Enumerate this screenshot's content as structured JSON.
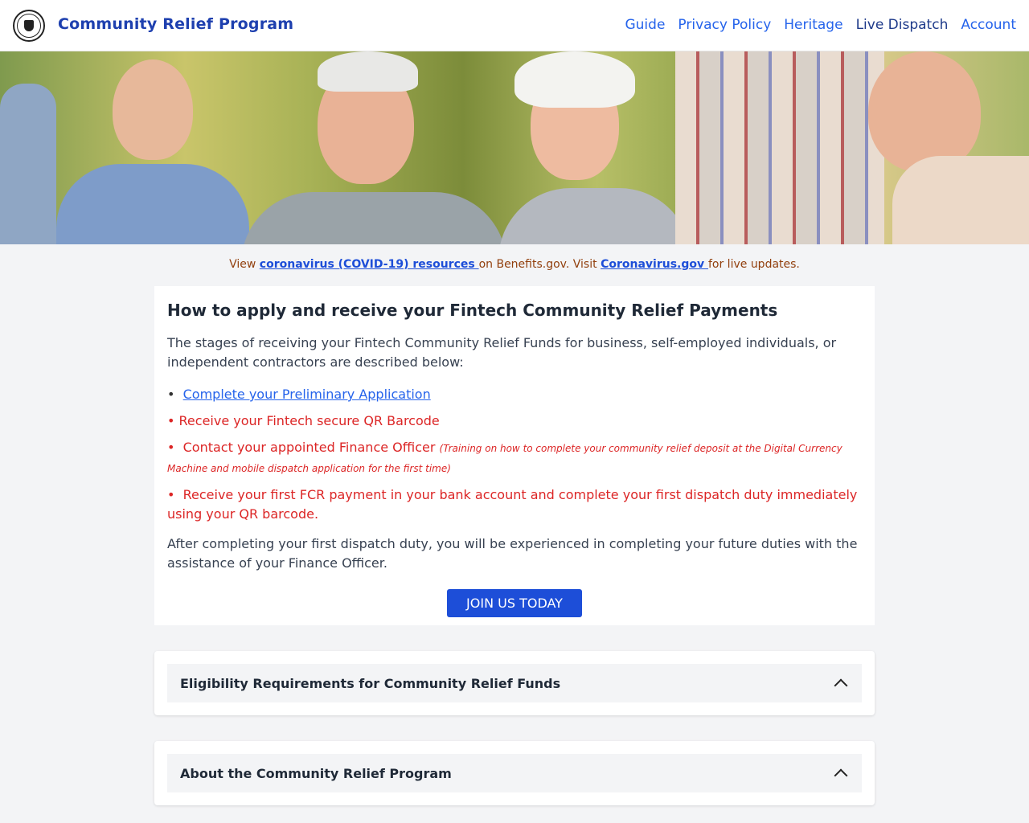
{
  "header": {
    "brand": "Community Relief Program",
    "nav": [
      {
        "label": "Guide"
      },
      {
        "label": "Privacy Policy"
      },
      {
        "label": "Heritage"
      },
      {
        "label": "Live Dispatch"
      },
      {
        "label": "Account"
      }
    ]
  },
  "notice": {
    "prefix": "View ",
    "link1": "coronavirus (COVID-19) resources ",
    "middle": "on Benefits.gov. Visit ",
    "link2": "Coronavirus.gov ",
    "suffix": "for live updates."
  },
  "main": {
    "title": "How to apply and receive your Fintech Community Relief Payments",
    "intro": "The stages of receiving your Fintech Community Relief Funds for business, self-employed individuals, or independent contractors are described below:",
    "steps": [
      {
        "text": "Complete your Preliminary Application"
      },
      {
        "text": "Receive your Fintech secure QR Barcode"
      },
      {
        "text": "Contact your appointed Finance Officer",
        "note": "(Training on how to complete your community relief deposit at the Digital Currency Machine and mobile dispatch application for the first time)"
      },
      {
        "text": "Receive your first FCR payment in your bank account and complete your first dispatch duty immediately using your QR barcode."
      }
    ],
    "outro": "After completing your first dispatch duty, you will be experienced in completing your future duties with the assistance of your Finance Officer.",
    "join_label": "JOIN US TODAY"
  },
  "accordions": [
    {
      "title": "Eligibility Requirements for Community Relief Funds"
    },
    {
      "title": "About the Community Relief Program"
    }
  ],
  "colors": {
    "brand": "#1e40af",
    "link": "#2563eb",
    "alert": "#dc2626",
    "button": "#1d4ed8"
  }
}
